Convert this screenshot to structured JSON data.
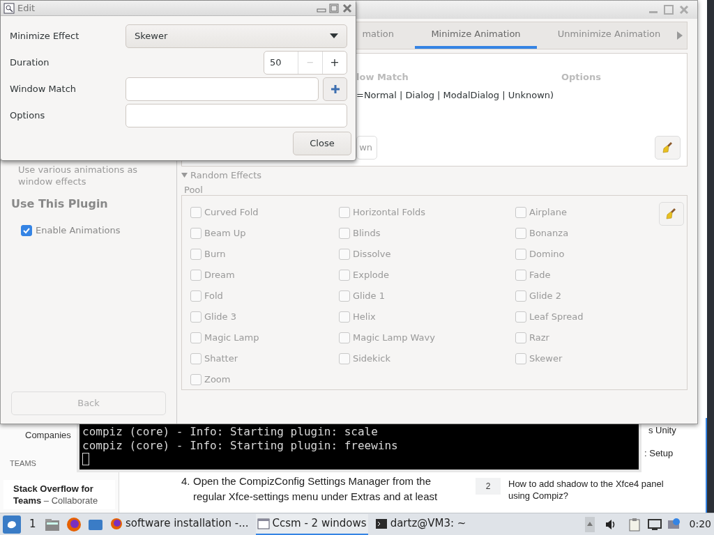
{
  "browser": {
    "sidebar": [
      {
        "kind": "link",
        "text": "Companies"
      },
      {
        "kind": "heading",
        "text": "TEAMS"
      },
      {
        "kind": "promo",
        "title": "Stack Overflow for Teams",
        "text": " – Collaborate"
      }
    ],
    "step": {
      "number": "4.",
      "lines": [
        "Open the CompizConfig Settings Manager from the",
        "regular Xfce-settings menu under Extras and at least"
      ]
    },
    "related": [
      {
        "text": "s Unity"
      },
      {
        "text": ": Setup"
      },
      {
        "count": "2",
        "text": "How to add shadow to the Xfce4 panel using Compiz?"
      }
    ]
  },
  "terminal": {
    "lines": [
      "compiz (core) - Info: Starting plugin: scale",
      "compiz (core) - Info: Starting plugin: freewins"
    ]
  },
  "ccsm": {
    "description": "Use various animations as window effects",
    "section": "Use This Plugin",
    "enable": {
      "label": "Enable Animations",
      "checked": true
    },
    "back": "Back",
    "tabs": [
      {
        "label": "mation",
        "selected": false
      },
      {
        "label": "Minimize Animation",
        "selected": true
      },
      {
        "label": "Unminimize Animation",
        "selected": false
      }
    ],
    "columns": [
      "low Match",
      "Options"
    ],
    "rows": [
      {
        "match": "=Normal | Dialog | ModalDialog | Unknown)"
      }
    ],
    "down_button": "wn",
    "expander": {
      "label": "Random Effects",
      "expanded": true
    },
    "pool": {
      "label": "Pool",
      "effects": [
        {
          "label": "Curved Fold",
          "checked": false
        },
        {
          "label": "Horizontal Folds",
          "checked": false
        },
        {
          "label": "Airplane",
          "checked": false
        },
        {
          "label": "Beam Up",
          "checked": false
        },
        {
          "label": "Blinds",
          "checked": false
        },
        {
          "label": "Bonanza",
          "checked": false
        },
        {
          "label": "Burn",
          "checked": false
        },
        {
          "label": "Dissolve",
          "checked": false
        },
        {
          "label": "Domino",
          "checked": false
        },
        {
          "label": "Dream",
          "checked": false
        },
        {
          "label": "Explode",
          "checked": false
        },
        {
          "label": "Fade",
          "checked": false
        },
        {
          "label": "Fold",
          "checked": false
        },
        {
          "label": "Glide 1",
          "checked": false
        },
        {
          "label": "Glide 2",
          "checked": false
        },
        {
          "label": "Glide 3",
          "checked": false
        },
        {
          "label": "Helix",
          "checked": false
        },
        {
          "label": "Leaf Spread",
          "checked": false
        },
        {
          "label": "Magic Lamp",
          "checked": false
        },
        {
          "label": "Magic Lamp Wavy",
          "checked": false
        },
        {
          "label": "Razr",
          "checked": false
        },
        {
          "label": "Shatter",
          "checked": false
        },
        {
          "label": "Sidekick",
          "checked": false
        },
        {
          "label": "Skewer",
          "checked": false
        },
        {
          "label": "Zoom",
          "checked": false
        }
      ]
    }
  },
  "edit_dialog": {
    "title": "Edit",
    "fields": [
      {
        "kind": "dropdown",
        "label": "Minimize Effect",
        "value": "Skewer"
      },
      {
        "kind": "spin",
        "label": "Duration",
        "value": "50",
        "decrement": {
          "label": "−",
          "disabled": true
        },
        "increment": {
          "label": "+",
          "disabled": false
        }
      },
      {
        "kind": "match",
        "label": "Window Match"
      },
      {
        "kind": "text",
        "label": "Options"
      }
    ],
    "close": "Close"
  },
  "taskbar": {
    "workspace": "1",
    "tasks": [
      {
        "kind": "browser",
        "label": "software installation -...",
        "selected": false
      },
      {
        "kind": "settings",
        "label": "Ccsm - 2 windows",
        "selected": true
      },
      {
        "kind": "terminal",
        "label": "dartz@VM3: ~",
        "selected": false
      }
    ],
    "clock": "0:20"
  }
}
